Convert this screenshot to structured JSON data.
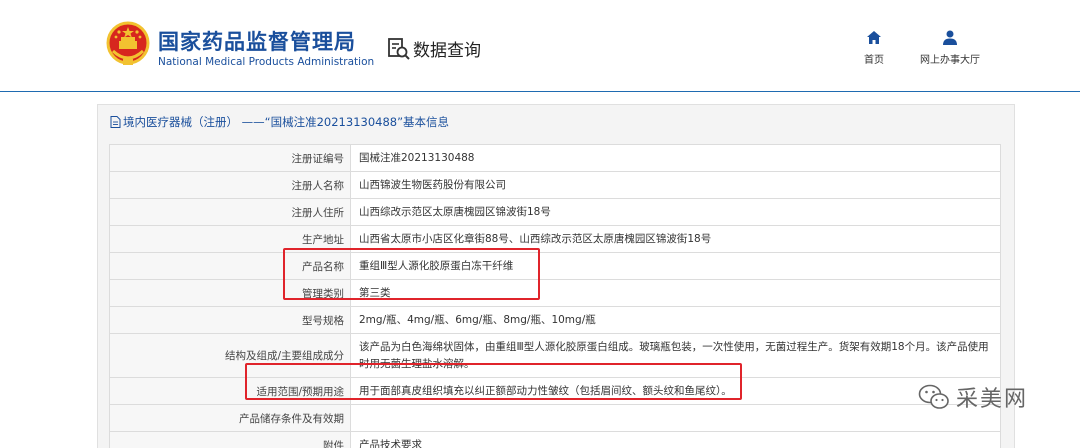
{
  "header": {
    "brand_cn": "国家药品监督管理局",
    "brand_en": "National Medical Products Administration",
    "query_label": "数据查询",
    "nav": [
      {
        "label": "首页",
        "icon": "home-icon"
      },
      {
        "label": "网上办事大厅",
        "icon": "user-icon"
      }
    ]
  },
  "panel": {
    "title": "境内医疗器械（注册） ——“国械注准20213130488”基本信息",
    "rows": [
      {
        "label": "注册证编号",
        "value": "国械注准20213130488"
      },
      {
        "label": "注册人名称",
        "value": "山西锦波生物医药股份有限公司"
      },
      {
        "label": "注册人住所",
        "value": "山西综改示范区太原唐槐园区锦波街18号"
      },
      {
        "label": "生产地址",
        "value": "山西省太原市小店区化章街88号、山西综改示范区太原唐槐园区锦波街18号"
      },
      {
        "label": "产品名称",
        "value": "重组Ⅲ型人源化胶原蛋白冻干纤维"
      },
      {
        "label": "管理类别",
        "value": "第三类"
      },
      {
        "label": "型号规格",
        "value": "2mg/瓶、4mg/瓶、6mg/瓶、8mg/瓶、10mg/瓶"
      },
      {
        "label": "结构及组成/主要组成成分",
        "value": "该产品为白色海绵状固体，由重组Ⅲ型人源化胶原蛋白组成。玻璃瓶包装，一次性使用，无菌过程生产。货架有效期18个月。该产品使用时用无菌生理盐水溶解。"
      },
      {
        "label": "适用范围/预期用途",
        "value": "用于面部真皮组织填充以纠正额部动力性皱纹（包括眉间纹、额头纹和鱼尾纹）。"
      },
      {
        "label": "产品储存条件及有效期",
        "value": ""
      },
      {
        "label": "附件",
        "value": "产品技术要求"
      }
    ]
  },
  "watermark": {
    "text": "采美网"
  },
  "colors": {
    "brand_blue": "#1a4f9c",
    "highlight_red": "#e0242b",
    "emblem_red": "#d7261e",
    "emblem_gold": "#f2c230"
  }
}
